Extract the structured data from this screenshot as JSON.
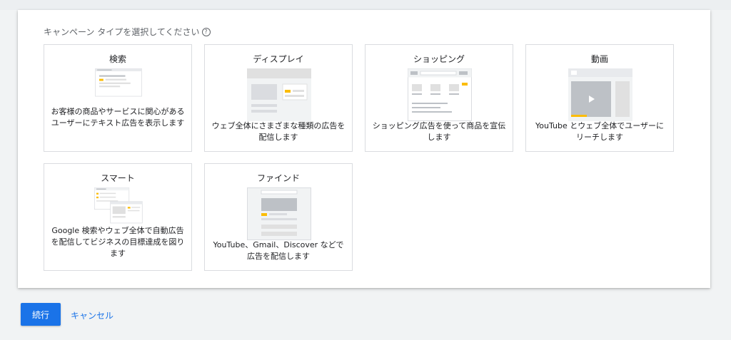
{
  "prompt": {
    "text": "キャンペーン タイプを選択してください",
    "help_glyph": "?"
  },
  "tiles": [
    {
      "title": "検索",
      "description": "お客様の商品やサービスに関心があるユーザーにテキスト広告を表示します",
      "icon": "search-ad-illustration"
    },
    {
      "title": "ディスプレイ",
      "description": "ウェブ全体にさまざまな種類の広告を配信します",
      "icon": "display-ad-illustration"
    },
    {
      "title": "ショッピング",
      "description": "ショッピング広告を使って商品を宣伝します",
      "icon": "shopping-ad-illustration"
    },
    {
      "title": "動画",
      "description": "YouTube とウェブ全体でユーザーにリーチします",
      "icon": "video-ad-illustration"
    },
    {
      "title": "スマート",
      "description": "Google 検索やウェブ全体で自動広告を配信してビジネスの目標達成を図ります",
      "icon": "smart-campaign-illustration"
    },
    {
      "title": "ファインド",
      "description": "YouTube、Gmail、Discover などで広告を配信します",
      "icon": "discovery-ad-illustration"
    }
  ],
  "actions": {
    "continue_label": "続行",
    "cancel_label": "キャンセル"
  },
  "colors": {
    "accent": "#1a73e8",
    "highlight": "#fbbc04",
    "border": "#dadce0"
  }
}
